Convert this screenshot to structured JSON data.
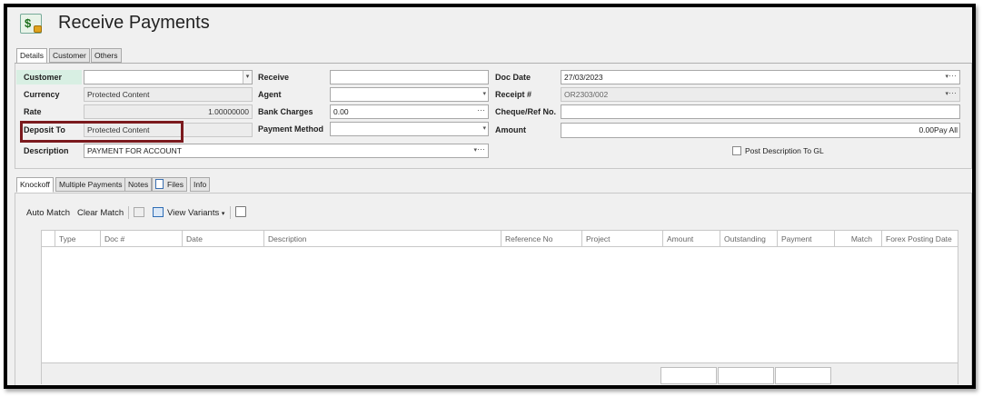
{
  "window": {
    "title": "Receive Payments",
    "app_icon": "money-icon"
  },
  "tabs": [
    "Details",
    "Customer",
    "Others"
  ],
  "form": {
    "customer": {
      "label": "Customer",
      "value": ""
    },
    "currency": {
      "label": "Currency",
      "value": "Protected Content"
    },
    "rate": {
      "label": "Rate",
      "value": "1.00000000"
    },
    "deposit_to": {
      "label": "Deposit To",
      "value": "Protected Content"
    },
    "description": {
      "label": "Description",
      "value": "PAYMENT FOR ACCOUNT"
    },
    "receive": {
      "label": "Receive",
      "value": ""
    },
    "agent": {
      "label": "Agent",
      "value": ""
    },
    "bank_charges": {
      "label": "Bank Charges",
      "value": "0.00"
    },
    "payment_method": {
      "label": "Payment Method",
      "value": ""
    },
    "doc_date": {
      "label": "Doc Date",
      "value": "27/03/2023"
    },
    "receipt_no": {
      "label": "Receipt #",
      "value": "OR2303/002"
    },
    "cheque_ref": {
      "label": "Cheque/Ref No.",
      "value": ""
    },
    "amount": {
      "label": "Amount",
      "value": "0.00",
      "pay_all": "Pay All"
    },
    "post_description": {
      "label": "Post Description To GL",
      "checked": false
    }
  },
  "detail_tabs": [
    "Knockoff",
    "Multiple Payments",
    "Notes",
    "Files",
    "Info"
  ],
  "toolbar": {
    "auto_match": "Auto Match",
    "clear_match": "Clear Match",
    "view_variants": "View Variants"
  },
  "grid": {
    "columns": [
      "Type",
      "Doc #",
      "Date",
      "Description",
      "Reference No",
      "Project",
      "Amount",
      "Outstanding",
      "Payment",
      "Match",
      "Forex Posting Date"
    ],
    "rows": []
  },
  "colors": {
    "highlight_border": "#7b1a1e",
    "customer_label_bg": "#d8efe3"
  }
}
